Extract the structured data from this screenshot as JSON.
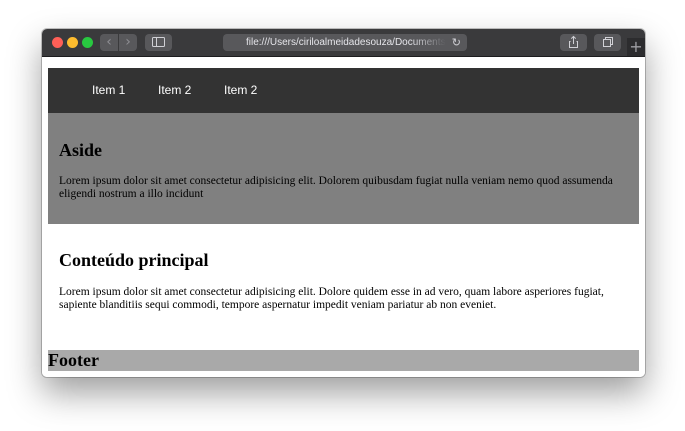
{
  "browser": {
    "url": "file:///Users/ciriloalmeidadesouza/Documents/",
    "back_glyph": "‹",
    "forward_glyph": "›",
    "reload_glyph": "↻",
    "new_tab_glyph": "+",
    "icons": [
      "sidebar-icon",
      "share-icon",
      "tabs-icon"
    ]
  },
  "nav": {
    "items": [
      {
        "label": "Item 1"
      },
      {
        "label": "Item 2"
      },
      {
        "label": "Item 2"
      }
    ]
  },
  "aside": {
    "heading": "Aside",
    "text": "Lorem ipsum dolor sit amet consectetur adipisicing elit. Dolorem quibusdam fugiat nulla veniam nemo quod assumenda eligendi nostrum a illo incidunt"
  },
  "main": {
    "heading": "Conteúdo principal",
    "text": "Lorem ipsum dolor sit amet consectetur adipisicing elit. Dolore quidem esse in ad vero, quam labore asperiores fugiat, sapiente blanditiis sequi commodi, tempore aspernatur impedit veniam pariatur ab non eveniet."
  },
  "footer": {
    "heading": "Footer"
  },
  "colors": {
    "nav_bg": "#333333",
    "aside_bg": "#808080",
    "footer_bg": "#a9a9a9",
    "toolbar_bg": "#3a3a3c"
  }
}
